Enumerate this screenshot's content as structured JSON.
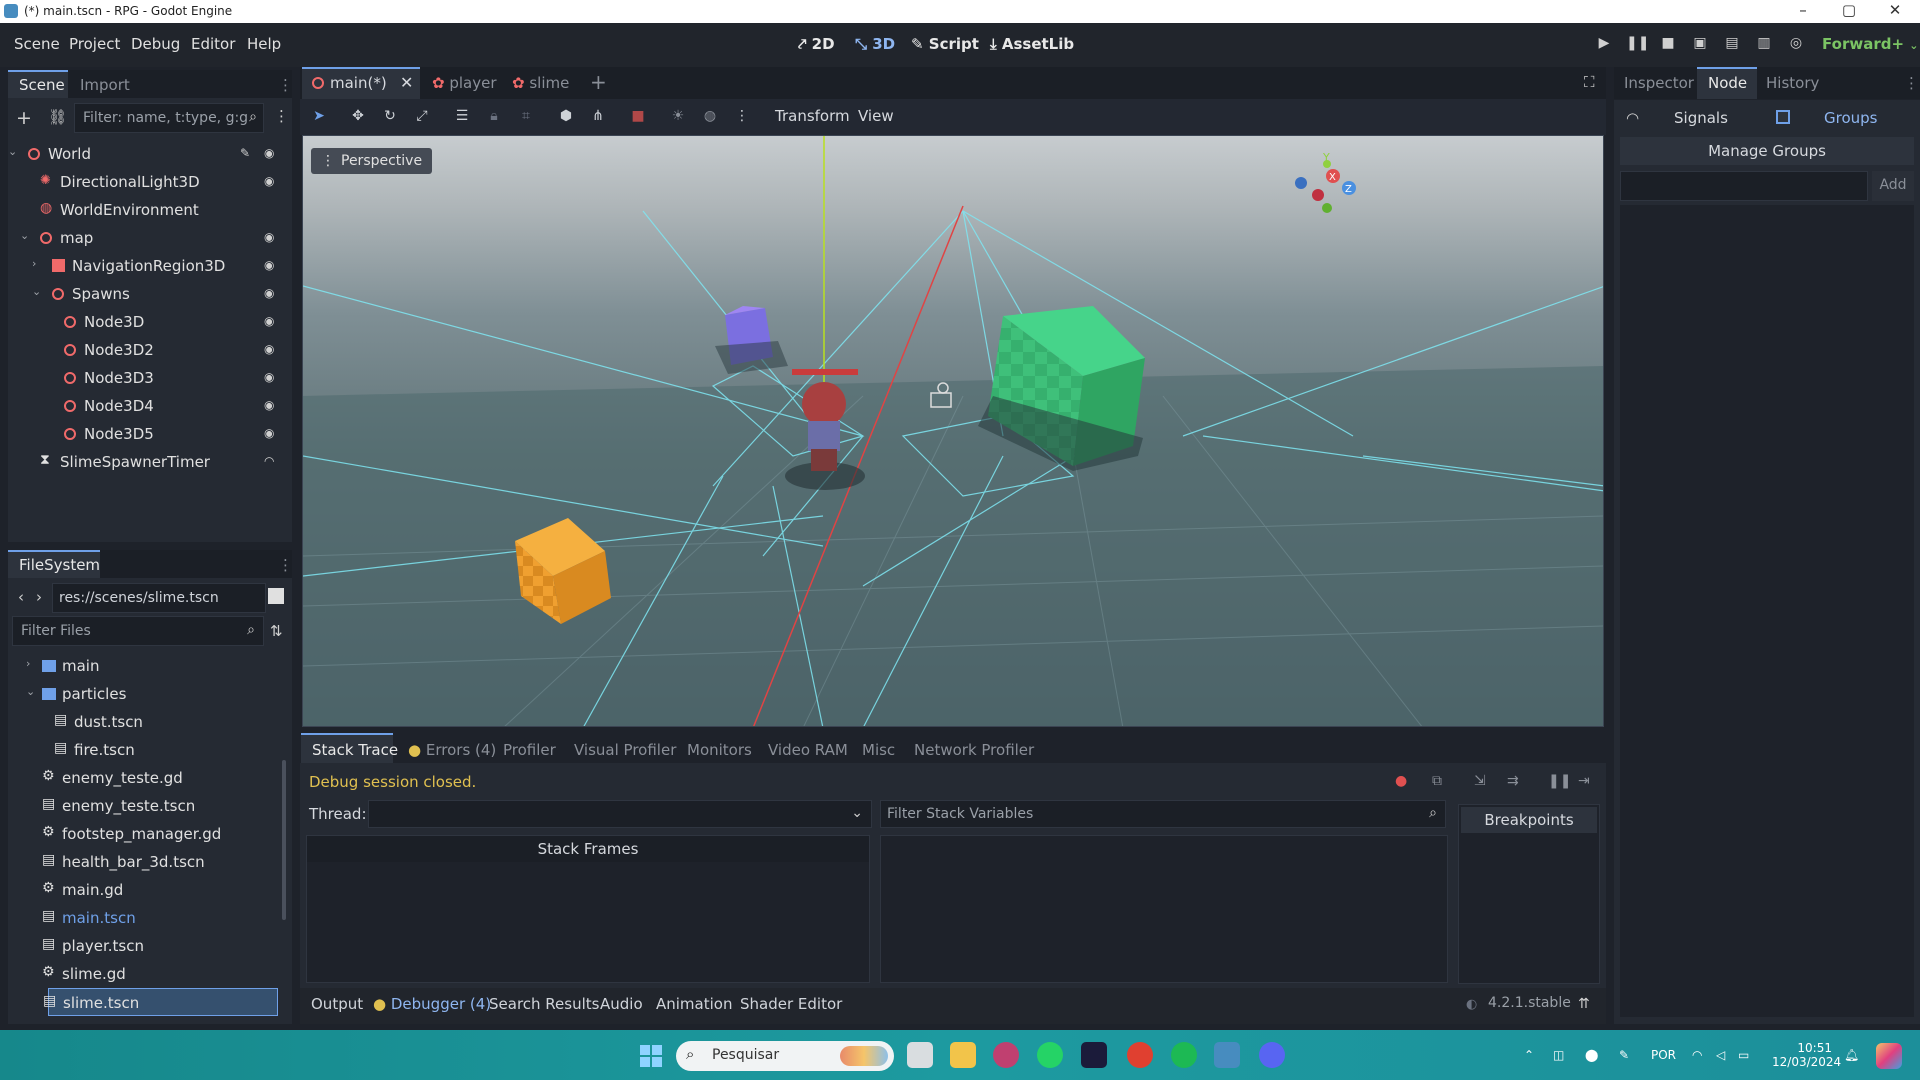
{
  "window": {
    "title": "(*) main.tscn - RPG - Godot Engine",
    "controls": [
      "–",
      "▢",
      "✕"
    ]
  },
  "menu": {
    "items": [
      "Scene",
      "Project",
      "Debug",
      "Editor",
      "Help"
    ],
    "workspaces": [
      "2D",
      "3D",
      "Script",
      "AssetLib"
    ],
    "active_workspace": "3D",
    "renderer": "Forward+"
  },
  "scene_dock": {
    "tabs": [
      "Scene",
      "Import"
    ],
    "filter_placeholder": "Filter: name, t:type, g:g",
    "tree": [
      {
        "label": "World",
        "icon": "node3d-icon",
        "depth": 0
      },
      {
        "label": "DirectionalLight3D",
        "icon": "light-icon",
        "depth": 1
      },
      {
        "label": "WorldEnvironment",
        "icon": "globe-icon",
        "depth": 1
      },
      {
        "label": "map",
        "icon": "node3d-icon",
        "depth": 1
      },
      {
        "label": "NavigationRegion3D",
        "icon": "navregion-icon",
        "depth": 2
      },
      {
        "label": "Spawns",
        "icon": "node3d-icon",
        "depth": 2
      },
      {
        "label": "Node3D",
        "icon": "node3d-icon",
        "depth": 3
      },
      {
        "label": "Node3D2",
        "icon": "node3d-icon",
        "depth": 3
      },
      {
        "label": "Node3D3",
        "icon": "node3d-icon",
        "depth": 3
      },
      {
        "label": "Node3D4",
        "icon": "node3d-icon",
        "depth": 3
      },
      {
        "label": "Node3D5",
        "icon": "node3d-icon",
        "depth": 3
      },
      {
        "label": "SlimeSpawnerTimer",
        "icon": "timer-icon",
        "depth": 1
      }
    ]
  },
  "filesystem": {
    "tab": "FileSystem",
    "path": "res://scenes/slime.tscn",
    "filter_placeholder": "Filter Files",
    "items": [
      {
        "label": "main",
        "type": "folder"
      },
      {
        "label": "particles",
        "type": "folder"
      },
      {
        "label": "dust.tscn",
        "type": "scene"
      },
      {
        "label": "fire.tscn",
        "type": "scene"
      },
      {
        "label": "enemy_teste.gd",
        "type": "script"
      },
      {
        "label": "enemy_teste.tscn",
        "type": "scene"
      },
      {
        "label": "footstep_manager.gd",
        "type": "script"
      },
      {
        "label": "health_bar_3d.tscn",
        "type": "scene"
      },
      {
        "label": "main.gd",
        "type": "script"
      },
      {
        "label": "main.tscn",
        "type": "scene"
      },
      {
        "label": "player.tscn",
        "type": "scene"
      },
      {
        "label": "slime.gd",
        "type": "script"
      },
      {
        "label": "slime.tscn",
        "type": "scene"
      }
    ],
    "selected": "slime.tscn",
    "highlighted": "main.tscn"
  },
  "editor_tabs": [
    {
      "label": "main(*)",
      "active": true
    },
    {
      "label": "player",
      "active": false
    },
    {
      "label": "slime",
      "active": false
    }
  ],
  "viewport_toolbar": {
    "transform": "Transform",
    "view": "View",
    "perspective": "Perspective"
  },
  "debugger": {
    "tabs": [
      "Stack Trace",
      "Errors (4)",
      "Profiler",
      "Visual Profiler",
      "Monitors",
      "Video RAM",
      "Misc",
      "Network Profiler"
    ],
    "status": "Debug session closed.",
    "thread_label": "Thread:",
    "filter_stack_placeholder": "Filter Stack Variables",
    "stack_frames": "Stack Frames",
    "breakpoints": "Breakpoints"
  },
  "bottom_panel": {
    "tabs": [
      "Output",
      "Debugger (4)",
      "Search Results",
      "Audio",
      "Animation",
      "Shader Editor"
    ],
    "version": "4.2.1.stable"
  },
  "right_dock": {
    "tabs": [
      "Inspector",
      "Node",
      "History"
    ],
    "signals": "Signals",
    "groups": "Groups",
    "manage_groups": "Manage Groups",
    "add": "Add"
  },
  "taskbar": {
    "search_placeholder": "Pesquisar",
    "language": "POR",
    "time": "10:51",
    "date": "12/03/2024"
  },
  "colors": {
    "accent": "#6fa0e8",
    "node_icon": "#f06a6a",
    "error_dot": "#e0c050",
    "status": "#e0c050"
  }
}
